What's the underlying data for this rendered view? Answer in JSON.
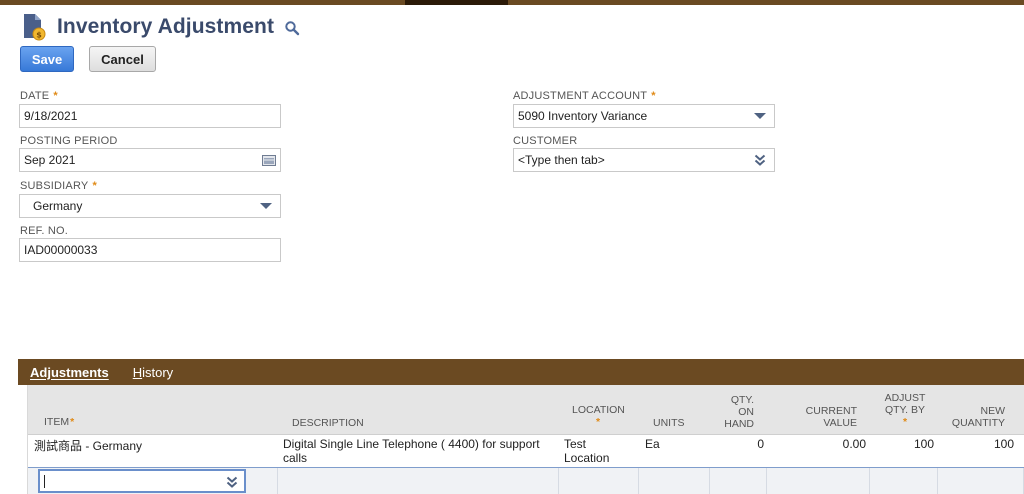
{
  "colors": {
    "brand_bar": "#6a4a22",
    "title": "#3a4a6b",
    "primary_button": "#3779d8",
    "required_star": "#e08a17"
  },
  "header": {
    "title": "Inventory Adjustment",
    "page_icon": "document-with-coin-icon",
    "search_icon": "magnifier-icon"
  },
  "toolbar": {
    "save_label": "Save",
    "cancel_label": "Cancel"
  },
  "form": {
    "date": {
      "label": "DATE",
      "required": "*",
      "value": "9/18/2021"
    },
    "posting_period": {
      "label": "POSTING PERIOD",
      "value": "Sep 2021"
    },
    "subsidiary": {
      "label": "SUBSIDIARY",
      "required": "*",
      "value": "Germany"
    },
    "ref_no": {
      "label": "REF. NO.",
      "value": "IAD00000033"
    },
    "adjustment_account": {
      "label": "ADJUSTMENT ACCOUNT",
      "required": "*",
      "value": "5090 Inventory Variance"
    },
    "customer": {
      "label": "CUSTOMER",
      "value": "<Type then tab>"
    }
  },
  "sublist": {
    "tabs": [
      {
        "label": "Adjustments",
        "accel": "A",
        "rest": "djustments"
      },
      {
        "label": "History",
        "accel": "H",
        "rest": "istory"
      }
    ],
    "columns": {
      "item": "ITEM",
      "item_req": "*",
      "description": "DESCRIPTION",
      "location": "LOCATION",
      "location_req": "*",
      "units": "UNITS",
      "qty_on_hand_1": "QTY.",
      "qty_on_hand_2": "ON",
      "qty_on_hand_3": "HAND",
      "current_value_1": "CURRENT",
      "current_value_2": "VALUE",
      "adjust_qty_1": "ADJUST",
      "adjust_qty_2": "QTY. BY",
      "adjust_qty_req": "*",
      "new_quantity_1": "NEW",
      "new_quantity_2": "QUANTITY"
    },
    "rows": [
      {
        "item": "測試商品 - Germany",
        "description_1": "Digital Single Line Telephone ( 4400) for support",
        "description_2": "calls",
        "location_1": "Test",
        "location_2": "Location",
        "units": "Ea",
        "qty_on_hand": "0",
        "current_value": "0.00",
        "adjust_qty_by": "100",
        "new_quantity": "100"
      }
    ]
  }
}
